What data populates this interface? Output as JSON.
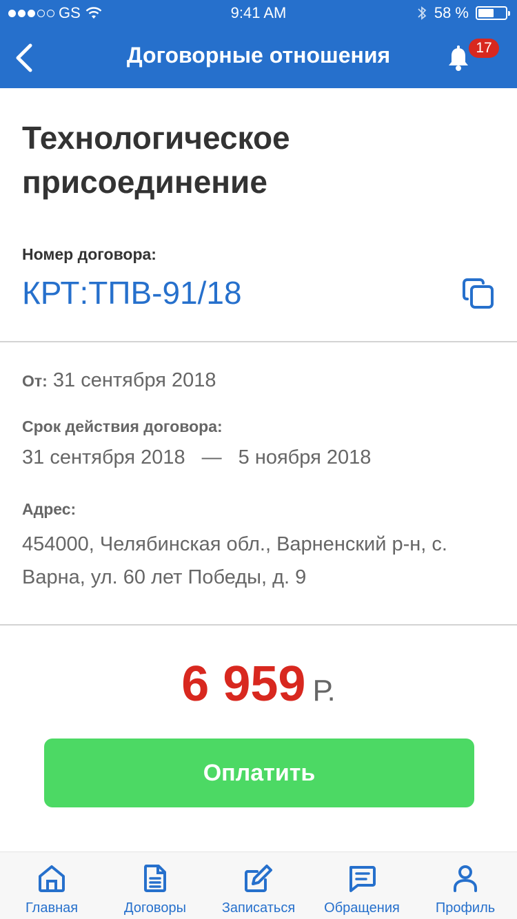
{
  "status_bar": {
    "carrier": "GS",
    "time": "9:41 AM",
    "battery_text": "58 %",
    "battery_level": 0.58
  },
  "nav": {
    "title": "Договорные отношения",
    "notification_count": "17"
  },
  "contract": {
    "title": "Технологическое присоединение",
    "number_label": "Номер договора:",
    "number": "КРТ:ТПВ-91/18",
    "from_label": "От:",
    "from_date": "31 сентября 2018",
    "term_label": "Срок действия договора:",
    "term_start": "31 сентября 2018",
    "term_dash": "—",
    "term_end": "5 ноября 2018",
    "address_label": "Адрес:",
    "address": "454000, Челябинская обл., Варненский р-н, с. Варна, ул. 60 лет Победы, д. 9"
  },
  "payment": {
    "amount": "6 959",
    "currency": "Р.",
    "pay_label": "Оплатить"
  },
  "tabs": [
    {
      "label": "Главная",
      "icon": "home-icon"
    },
    {
      "label": "Договоры",
      "icon": "document-icon"
    },
    {
      "label": "Записаться",
      "icon": "edit-icon"
    },
    {
      "label": "Обращения",
      "icon": "chat-icon"
    },
    {
      "label": "Профиль",
      "icon": "person-icon"
    }
  ],
  "colors": {
    "primary": "#2670cc",
    "accent_red": "#d8281f",
    "pay_green": "#4cd964",
    "text_dark": "#333333",
    "text_gray": "#666666"
  }
}
